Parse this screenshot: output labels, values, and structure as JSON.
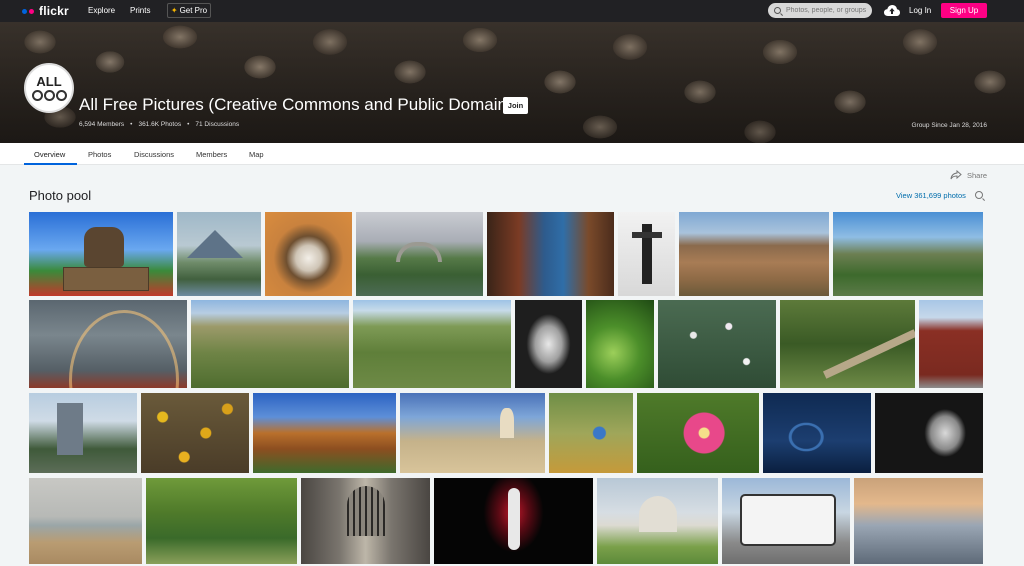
{
  "topbar": {
    "logo": "flickr",
    "nav": [
      "Explore",
      "Prints"
    ],
    "get_pro": "Get Pro",
    "search_placeholder": "Photos, people, or groups",
    "login": "Log In",
    "signup": "Sign Up"
  },
  "group": {
    "logo_text": "ALL",
    "title": "All Free Pictures (Creative Commons and Public Domain)",
    "join": "Join",
    "members": "6,594 Members",
    "photos": "361.6K Photos",
    "discussions": "71 Discussions",
    "since": "Group Since Jan 28, 2016"
  },
  "subnav": {
    "items": [
      "Overview",
      "Photos",
      "Discussions",
      "Members",
      "Map"
    ]
  },
  "share": "Share",
  "pool": {
    "title": "Photo pool",
    "view_all": "View 361,699 photos"
  },
  "colors": {
    "accent": "#0063dc",
    "signup": "#ff0084",
    "link": "#006dac"
  },
  "photo_subjects": [
    "baseball play ball statue",
    "mountain over harbor town",
    "animal in pipe",
    "old stone bridge",
    "market stall costumes",
    "statue on pole",
    "red hills",
    "green landscape mountains",
    "double rainbow",
    "steppe shrubs",
    "field with path",
    "woman portrait",
    "green plant macro",
    "white flowers",
    "fallen tree forest",
    "red brick building",
    "city tower building",
    "yellow flowers",
    "cliff over water",
    "seaside promenade statue",
    "kingfisher bird",
    "pink flower",
    "blue car dashboard",
    "old man portrait",
    "beach people",
    "green forest river",
    "stone corridor",
    "dancer in red light",
    "classical rotunda",
    "double decker bus",
    "pier at sunset"
  ]
}
